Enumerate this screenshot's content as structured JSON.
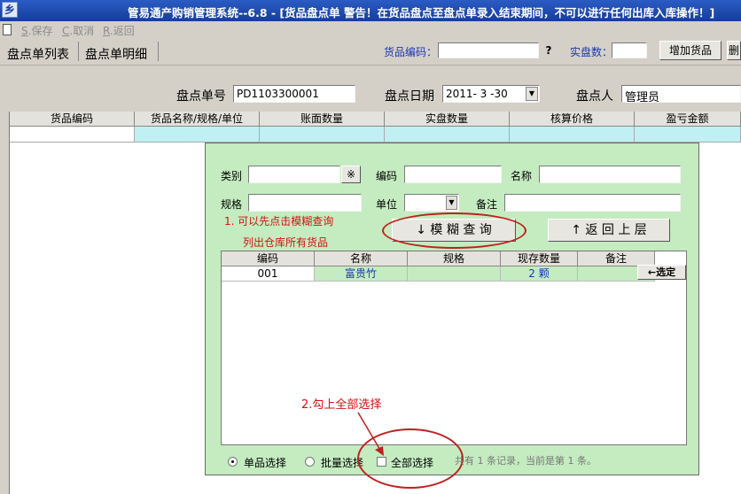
{
  "window": {
    "title": "管易通产购销管理系统--6.8 - [货品盘点单  警告！在货品盘点至盘点单录入结束期间，不可以进行任何出库入库操作！]",
    "icon_char": "乡"
  },
  "toolbar": {
    "save": {
      "key": "S",
      "label": ".保存"
    },
    "cancel": {
      "key": "C",
      "label": ".取消"
    },
    "back": {
      "key": "R",
      "label": ".返回"
    }
  },
  "tabs": [
    "盘点单列表",
    "盘点单明细"
  ],
  "search": {
    "goods_code_label": "货品编码：",
    "goods_code_value": "",
    "help_button": "?",
    "actual_qty_label": "实盘数：",
    "actual_qty_value": "",
    "add_button": "增加货品",
    "extra_button": "删"
  },
  "header": {
    "doc_no_label": "盘点单号",
    "doc_no_value": "PD1103300001",
    "date_label": "盘点日期",
    "date_value": "2011- 3 -30",
    "counter_label": "盘点人",
    "counter_value": "管理员"
  },
  "grid": {
    "columns": [
      "货品编码",
      "货品名称/规格/单位",
      "账面数量",
      "实盘数量",
      "核算价格",
      "盈亏金额"
    ]
  },
  "dialog": {
    "category_label": "类别",
    "category_value": "",
    "category_btn": "※",
    "code_label": "编码",
    "code_value": "",
    "name_label": "名称",
    "name_value": "",
    "spec_label": "规格",
    "spec_value": "",
    "unit_label": "单位",
    "unit_value": "",
    "note_label": "备注",
    "note_value": "",
    "annotation_1a": "1.  可以先点击模糊查询",
    "annotation_1b": "列出仓库所有货品",
    "fuzzy_button": "↓  模 糊 查 询",
    "back_button": "↑  返 回 上 层",
    "list": {
      "columns": [
        "编码",
        "名称",
        "规格",
        "现存数量",
        "备注"
      ],
      "rows": [
        {
          "code": "001",
          "name": "富贵竹",
          "spec": "",
          "stock": "2 颗",
          "note": ""
        }
      ],
      "select_button": "←选定"
    },
    "annotation_2": "2.勾上全部选择",
    "radio_single": "单品选择",
    "radio_batch": "批量选择",
    "check_all": "全部选择",
    "status": "共有 1 条记录，当前是第 1 条。"
  }
}
